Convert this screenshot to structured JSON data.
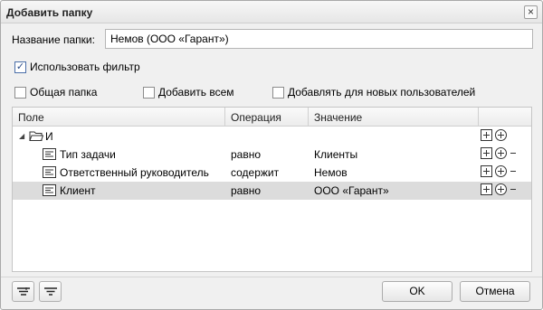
{
  "dialog": {
    "title": "Добавить папку",
    "close_glyph": "×"
  },
  "folder_name": {
    "label": "Название папки:",
    "value": "Немов (ООО «Гарант»)"
  },
  "use_filter": {
    "label": "Использовать фильтр",
    "checked": true,
    "glyph": "✓"
  },
  "options": [
    {
      "label": "Общая папка",
      "checked": false
    },
    {
      "label": "Добавить всем",
      "checked": false
    },
    {
      "label": "Добавлять для новых пользователей",
      "checked": false
    }
  ],
  "grid": {
    "columns": [
      "Поле",
      "Операция",
      "Значение"
    ],
    "group": {
      "label": "И",
      "arrow": "◢"
    },
    "rows": [
      {
        "field": "Тип задачи",
        "operation": "равно",
        "value": "Клиенты",
        "selected": false
      },
      {
        "field": "Ответственный руководитель",
        "operation": "содержит",
        "value": "Немов",
        "selected": false
      },
      {
        "field": "Клиент",
        "operation": "равно",
        "value": "ООО «Гарант»",
        "selected": true
      }
    ]
  },
  "footer": {
    "ok_label": "OK",
    "cancel_label": "Отмена"
  },
  "colors": {
    "selected_row": "#dcdcdc",
    "checkbox_accent": "#2a4b87"
  }
}
